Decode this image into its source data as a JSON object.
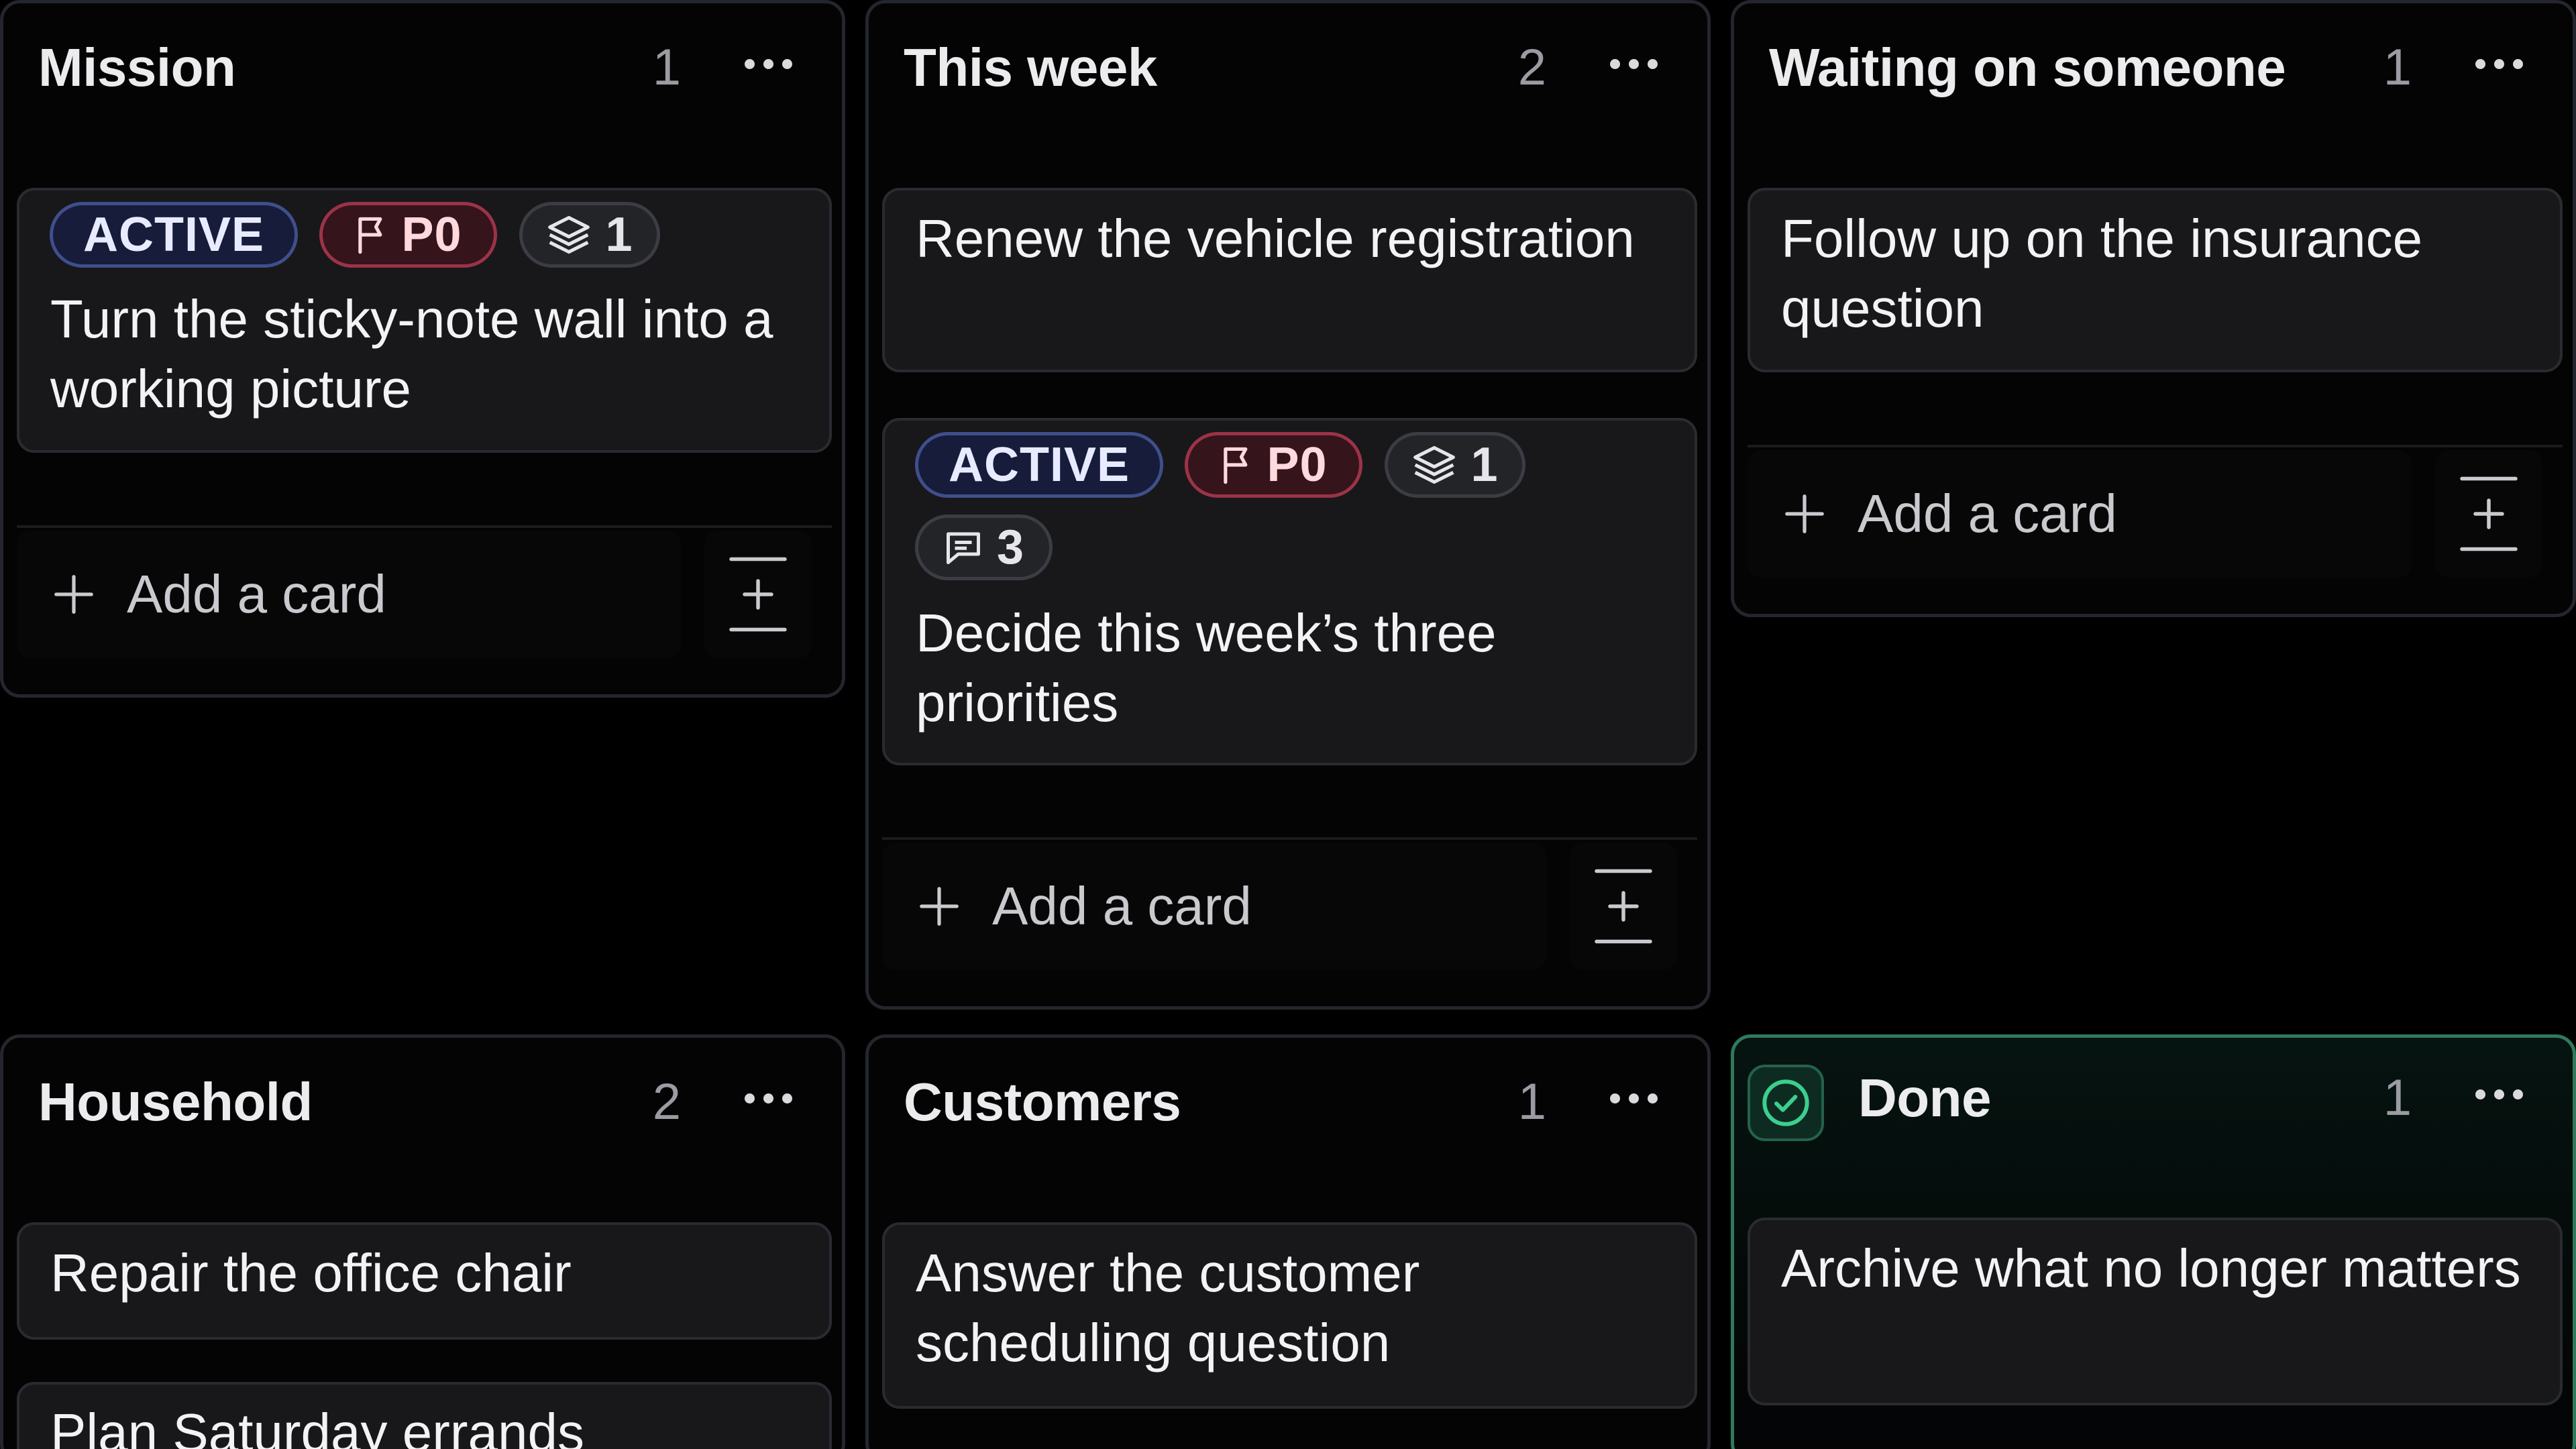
{
  "board": {
    "add_card_label": "Add a card",
    "columns": [
      {
        "title": "Mission",
        "count": "1",
        "cards": [
          {
            "title": "Turn the sticky-note wall into a working picture",
            "status_badge": "ACTIVE",
            "priority_badge": "P0",
            "subitems_count": "1"
          }
        ]
      },
      {
        "title": "This week",
        "count": "2",
        "cards": [
          {
            "title": "Renew the vehicle registration"
          },
          {
            "title": "Decide this week’s three priorities",
            "status_badge": "ACTIVE",
            "priority_badge": "P0",
            "subitems_count": "1",
            "comments_count": "3"
          }
        ]
      },
      {
        "title": "Waiting on someone",
        "count": "1",
        "cards": [
          {
            "title": "Follow up on the insurance question"
          }
        ]
      },
      {
        "title": "Household",
        "count": "2",
        "cards": [
          {
            "title": "Repair the office chair"
          },
          {
            "title": "Plan Saturday errands"
          }
        ]
      },
      {
        "title": "Customers",
        "count": "1",
        "cards": [
          {
            "title": "Answer the customer scheduling question"
          }
        ]
      },
      {
        "title": "Done",
        "count": "1",
        "cards": [
          {
            "title": "Archive what no longer matters"
          }
        ]
      }
    ]
  },
  "icons": {
    "priority": "flag-icon",
    "subitems": "layers-icon",
    "comments": "comment-icon",
    "more": "more-horizontal-icon",
    "add": "plus-icon",
    "add_split": "insert-divider-icon",
    "done": "check-circle-icon"
  },
  "colors": {
    "active_badge": "#3f4f8c",
    "priority_badge": "#9c3348",
    "done_accent": "#2f7a5c",
    "done_check": "#3ccf8e"
  }
}
